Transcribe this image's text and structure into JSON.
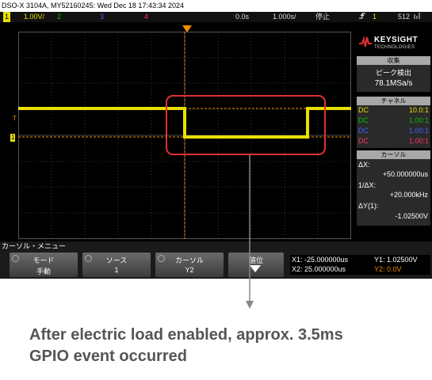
{
  "scope": {
    "title_bar": "DSO-X 3104A, MY52160245: Wed Dec 18 17:43:34 2024",
    "status": {
      "ch1_num": "1",
      "ch1_scale": "1.00V/",
      "ch2_num": "2",
      "ch3_num": "3",
      "ch4_num": "4",
      "time_pos": "0.0s",
      "time_scale": "1.000s/",
      "run_state": "停止",
      "trigger_icon": "trigger-edge-icon",
      "trig_ch": "1",
      "trig_level": "512",
      "trig_unit_icon": "signal-icon"
    },
    "colors": {
      "ch1": "#e8e000",
      "ch2": "#00c000",
      "ch3": "#4060ff",
      "ch4": "#ff3060",
      "highlight": "#e03030"
    },
    "markers": {
      "ground": "1",
      "trigger_level": "T"
    },
    "logo": {
      "brand": "KEYSIGHT",
      "tagline": "TECHNOLOGIES"
    },
    "acquisition": {
      "header": "収集",
      "mode": "ピーク検出",
      "rate": "78.1MSa/s"
    },
    "channels": {
      "header": "チャネル",
      "rows": [
        {
          "coupling": "DC",
          "ratio": "10.0:1",
          "color": "#e8e000"
        },
        {
          "coupling": "DC",
          "ratio": "1.00:1",
          "color": "#00c000"
        },
        {
          "coupling": "DC",
          "ratio": "1.00:1",
          "color": "#4060ff"
        },
        {
          "coupling": "DC",
          "ratio": "1.00:1",
          "color": "#ff3060"
        }
      ]
    },
    "cursor": {
      "header": "カーソル",
      "dx_label": "ΔX:",
      "dx_value": "+50.000000us",
      "inv_dx_label": "1/ΔX:",
      "inv_dx_value": "+20.000kHz",
      "dy_label": "ΔY(1):",
      "dy_value": "-1.02500V"
    },
    "menu": {
      "title": "カーソル・メニュー",
      "softkeys": [
        {
          "label": "モード",
          "value": "手動"
        },
        {
          "label": "ソース",
          "value": "1"
        },
        {
          "label": "カーソル",
          "value": "Y2"
        },
        {
          "label": "値位",
          "value": ""
        }
      ]
    },
    "readout": {
      "x1": "X1: -25.000000us",
      "x2": "X2: 25.000000us",
      "y1": "Y1: 1.02500V",
      "y2": "Y2: 0.0V"
    }
  },
  "caption": {
    "line1": "After electric load enabled, approx. 3.5ms",
    "line2": "GPIO event occurred"
  }
}
